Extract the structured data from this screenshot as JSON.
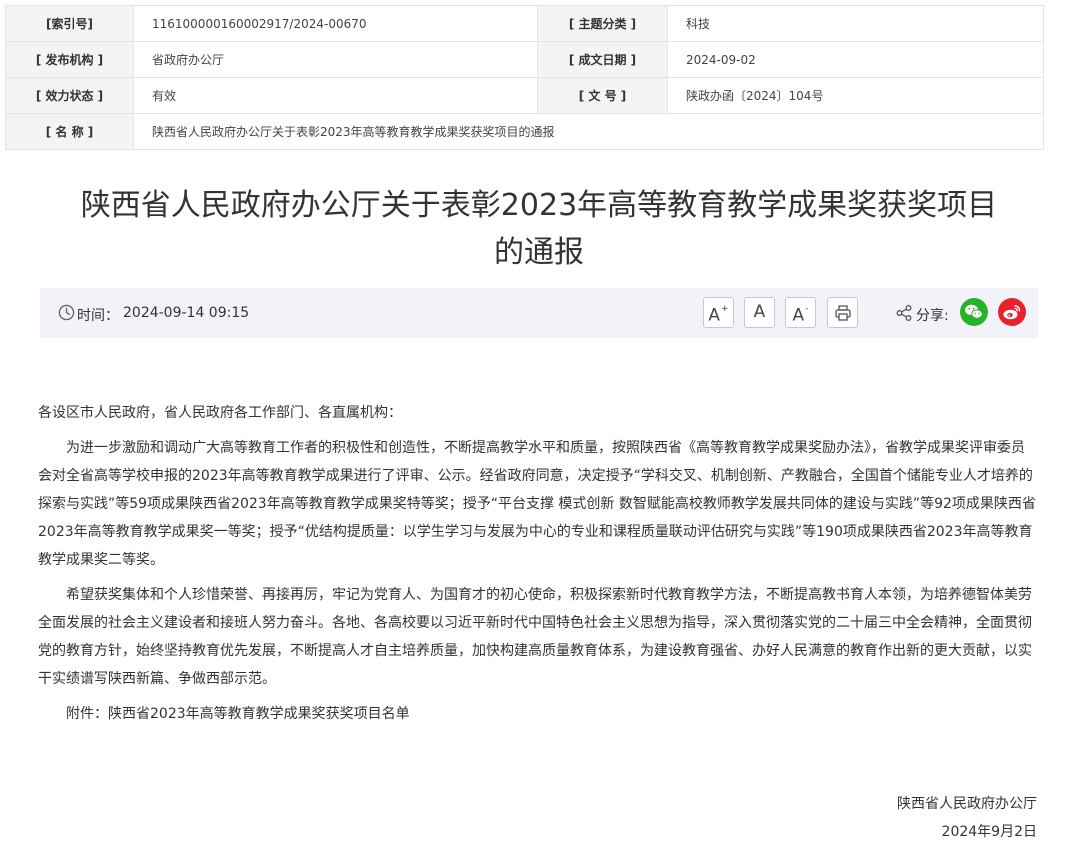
{
  "meta": {
    "index_label": "[索引号]",
    "index_value": "116100000160002917/2024-00670",
    "topic_label": "[ 主题分类 ]",
    "topic_value": "科技",
    "publisher_label": "[ 发布机构 ]",
    "publisher_value": "省政府办公厅",
    "date_label": "[ 成文日期 ]",
    "date_value": "2024-09-02",
    "status_label": "[ 效力状态 ]",
    "status_value": "有效",
    "docno_label": "[ 文 号 ]",
    "docno_value": "陕政办函〔2024〕104号",
    "name_label": "[ 名 称 ]",
    "name_value": "陕西省人民政府办公厅关于表彰2023年高等教育教学成果奖获奖项目的通报"
  },
  "article": {
    "title_line1": "陕西省人民政府办公厅关于表彰2023年高等教育教学成果奖获奖项目",
    "title_line2": "的通报"
  },
  "infobar": {
    "time_label": "时间：",
    "time_value": "2024-09-14 09:15",
    "font_increase": "A",
    "font_increase_sup": "+",
    "font_normal": "A",
    "font_decrease": "A",
    "font_decrease_sup": "-",
    "share_label": "分享:",
    "icons": [
      "clock-icon",
      "print-icon",
      "share-icon",
      "wechat-icon",
      "weibo-icon"
    ],
    "colors": {
      "wechat": "#27b227",
      "weibo": "#e8222d",
      "bar_bg": "#f2f2f8"
    }
  },
  "content": {
    "greeting": "各设区市人民政府，省人民政府各工作部门、各直属机构：",
    "para1": "为进一步激励和调动广大高等教育工作者的积极性和创造性，不断提高教学水平和质量，按照陕西省《高等教育教学成果奖励办法》，省教学成果奖评审委员会对全省高等学校申报的2023年高等教育教学成果进行了评审、公示。经省政府同意，决定授予“学科交叉、机制创新、产教融合，全国首个储能专业人才培养的探索与实践”等59项成果陕西省2023年高等教育教学成果奖特等奖；授予“平台支撑 模式创新 数智赋能高校教师教学发展共同体的建设与实践”等92项成果陕西省2023年高等教育教学成果奖一等奖；授予“优结构提质量：以学生学习与发展为中心的专业和课程质量联动评估研究与实践”等190项成果陕西省2023年高等教育教学成果奖二等奖。",
    "para2": "希望获奖集体和个人珍惜荣誉、再接再厉，牢记为党育人、为国育才的初心使命，积极探索新时代教育教学方法，不断提高教书育人本领，为培养德智体美劳全面发展的社会主义建设者和接班人努力奋斗。各地、各高校要以习近平新时代中国特色社会主义思想为指导，深入贯彻落实党的二十届三中全会精神，全面贯彻党的教育方针，始终坚持教育优先发展，不断提高人才自主培养质量，加快构建高质量教育体系，为建设教育强省、办好人民满意的教育作出新的更大贡献，以实干实绩谱写陕西新篇、争做西部示范。",
    "attachment": "附件：陕西省2023年高等教育教学成果奖获奖项目名单",
    "signature": "陕西省人民政府办公厅",
    "sign_date": "2024年9月2日"
  }
}
